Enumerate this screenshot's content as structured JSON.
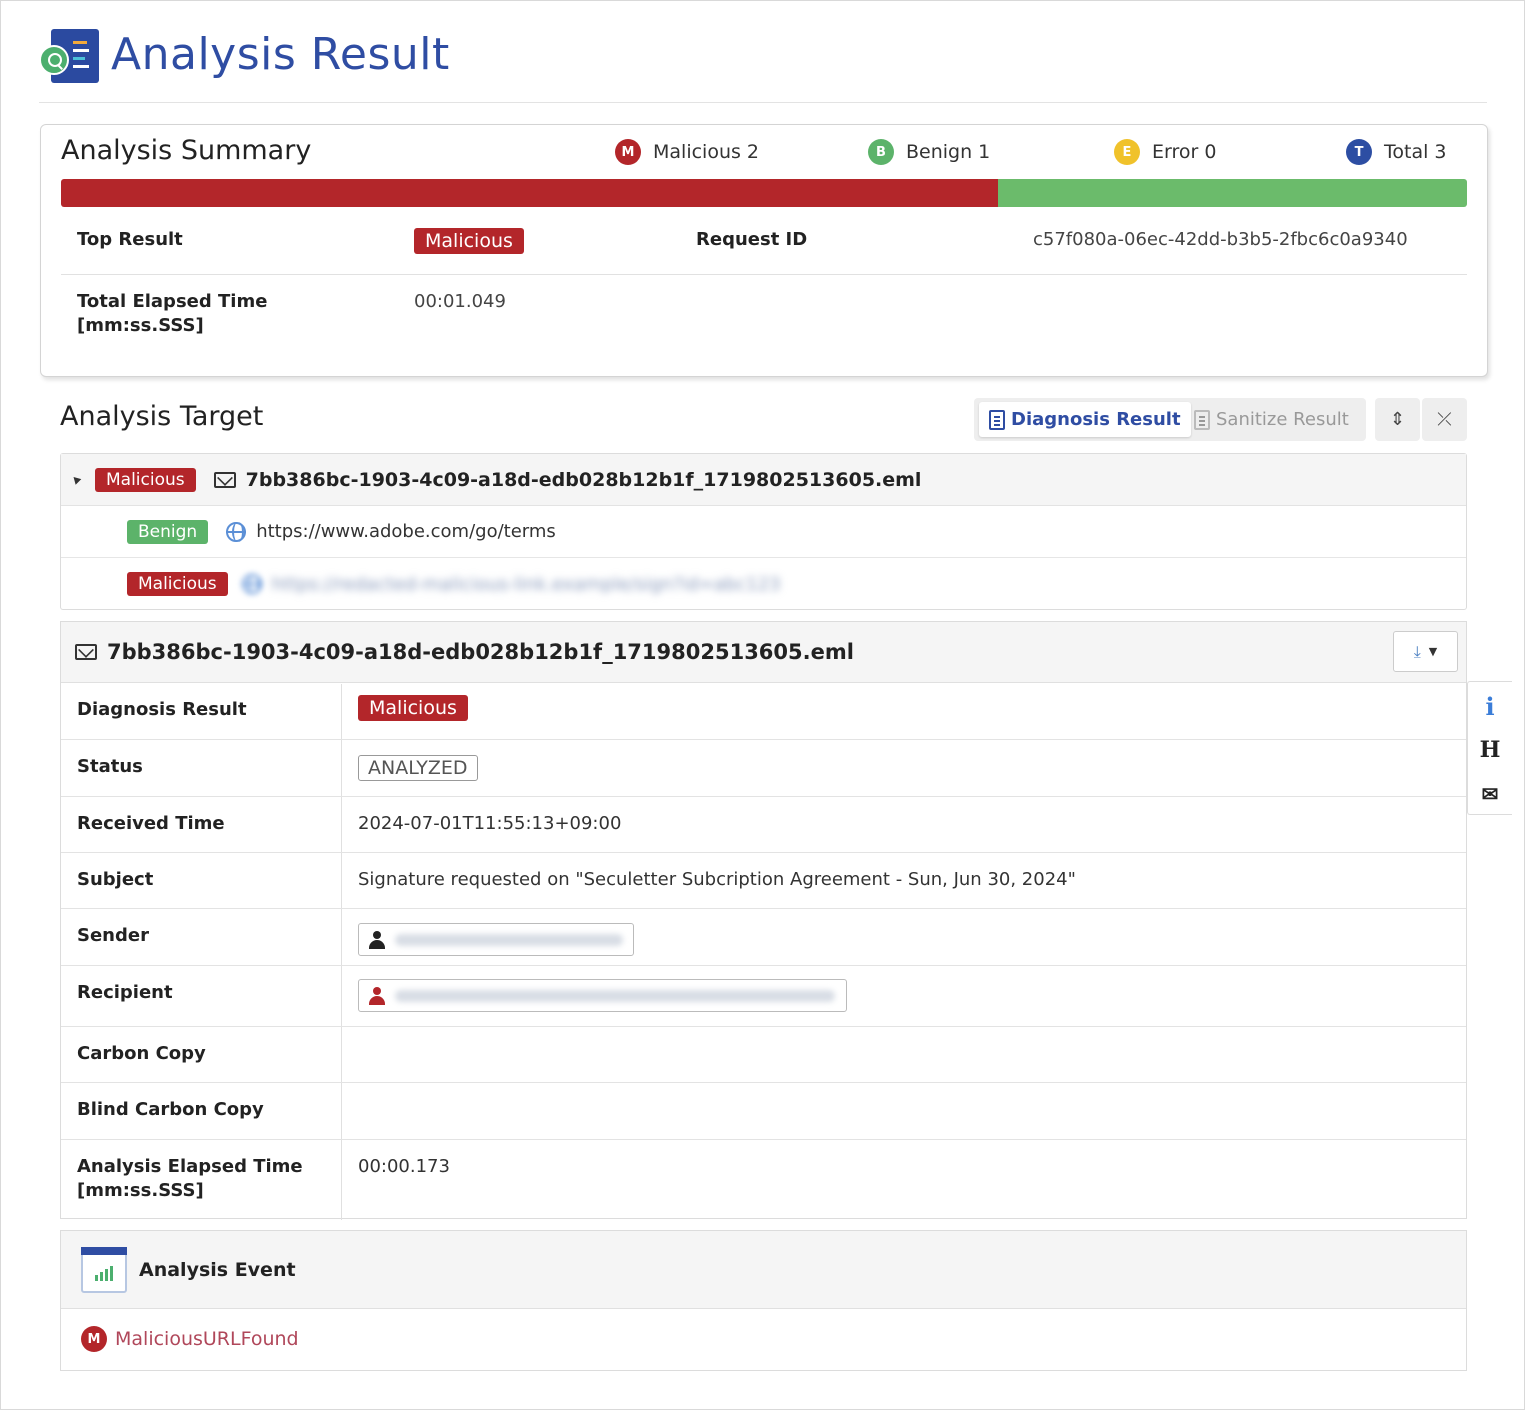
{
  "header": {
    "title": "Analysis Result"
  },
  "summary": {
    "title": "Analysis Summary",
    "counts": [
      {
        "letter": "M",
        "label": "Malicious 2",
        "color": "#b3262a"
      },
      {
        "letter": "B",
        "label": "Benign 1",
        "color": "#5cb36a"
      },
      {
        "letter": "E",
        "label": "Error 0",
        "color": "#f0c22b"
      },
      {
        "letter": "T",
        "label": "Total 3",
        "color": "#2d4ea3"
      }
    ],
    "bar": [
      {
        "name": "malicious",
        "value": 2,
        "color": "#b3262a"
      },
      {
        "name": "benign",
        "value": 1,
        "color": "#6bbb6b"
      }
    ],
    "top_result_label": "Top Result",
    "top_result_value": "Malicious",
    "request_id_label": "Request ID",
    "request_id_value": "c57f080a-06ec-42dd-b3b5-2fbc6c0a9340",
    "elapsed_label": "Total Elapsed Time\n[mm:ss.SSS]",
    "elapsed_value": "00:01.049"
  },
  "target": {
    "title": "Analysis Target",
    "tab_diagnosis": "Diagnosis Result",
    "tab_sanitize": "Sanitize Result",
    "tree": {
      "root": {
        "badge": "Malicious",
        "name": "7bb386bc-1903-4c09-a18d-edb028b12b1f_1719802513605.eml"
      },
      "children": [
        {
          "badge": "Benign",
          "url": "https://www.adobe.com/go/terms"
        },
        {
          "badge": "Malicious",
          "url": "https://redacted-malicious-link.example/sign?id=abc123"
        }
      ]
    }
  },
  "detail": {
    "file_name": "7bb386bc-1903-4c09-a18d-edb028b12b1f_1719802513605.eml",
    "rows": {
      "diagnosis_label": "Diagnosis Result",
      "diagnosis_value": "Malicious",
      "status_label": "Status",
      "status_value": "ANALYZED",
      "received_label": "Received Time",
      "received_value": "2024-07-01T11:55:13+09:00",
      "subject_label": "Subject",
      "subject_value": "Signature requested on \"Seculetter Subcription Agreement - Sun, Jun 30, 2024\"",
      "sender_label": "Sender",
      "recipient_label": "Recipient",
      "cc_label": "Carbon Copy",
      "bcc_label": "Blind Carbon Copy",
      "elapsed_label": "Analysis Elapsed Time\n[mm:ss.SSS]",
      "elapsed_value": "00:00.173"
    }
  },
  "event": {
    "title": "Analysis Event",
    "items": [
      {
        "letter": "M",
        "name": "MaliciousURLFound"
      }
    ]
  },
  "side": {
    "info": "i",
    "header": "H"
  }
}
